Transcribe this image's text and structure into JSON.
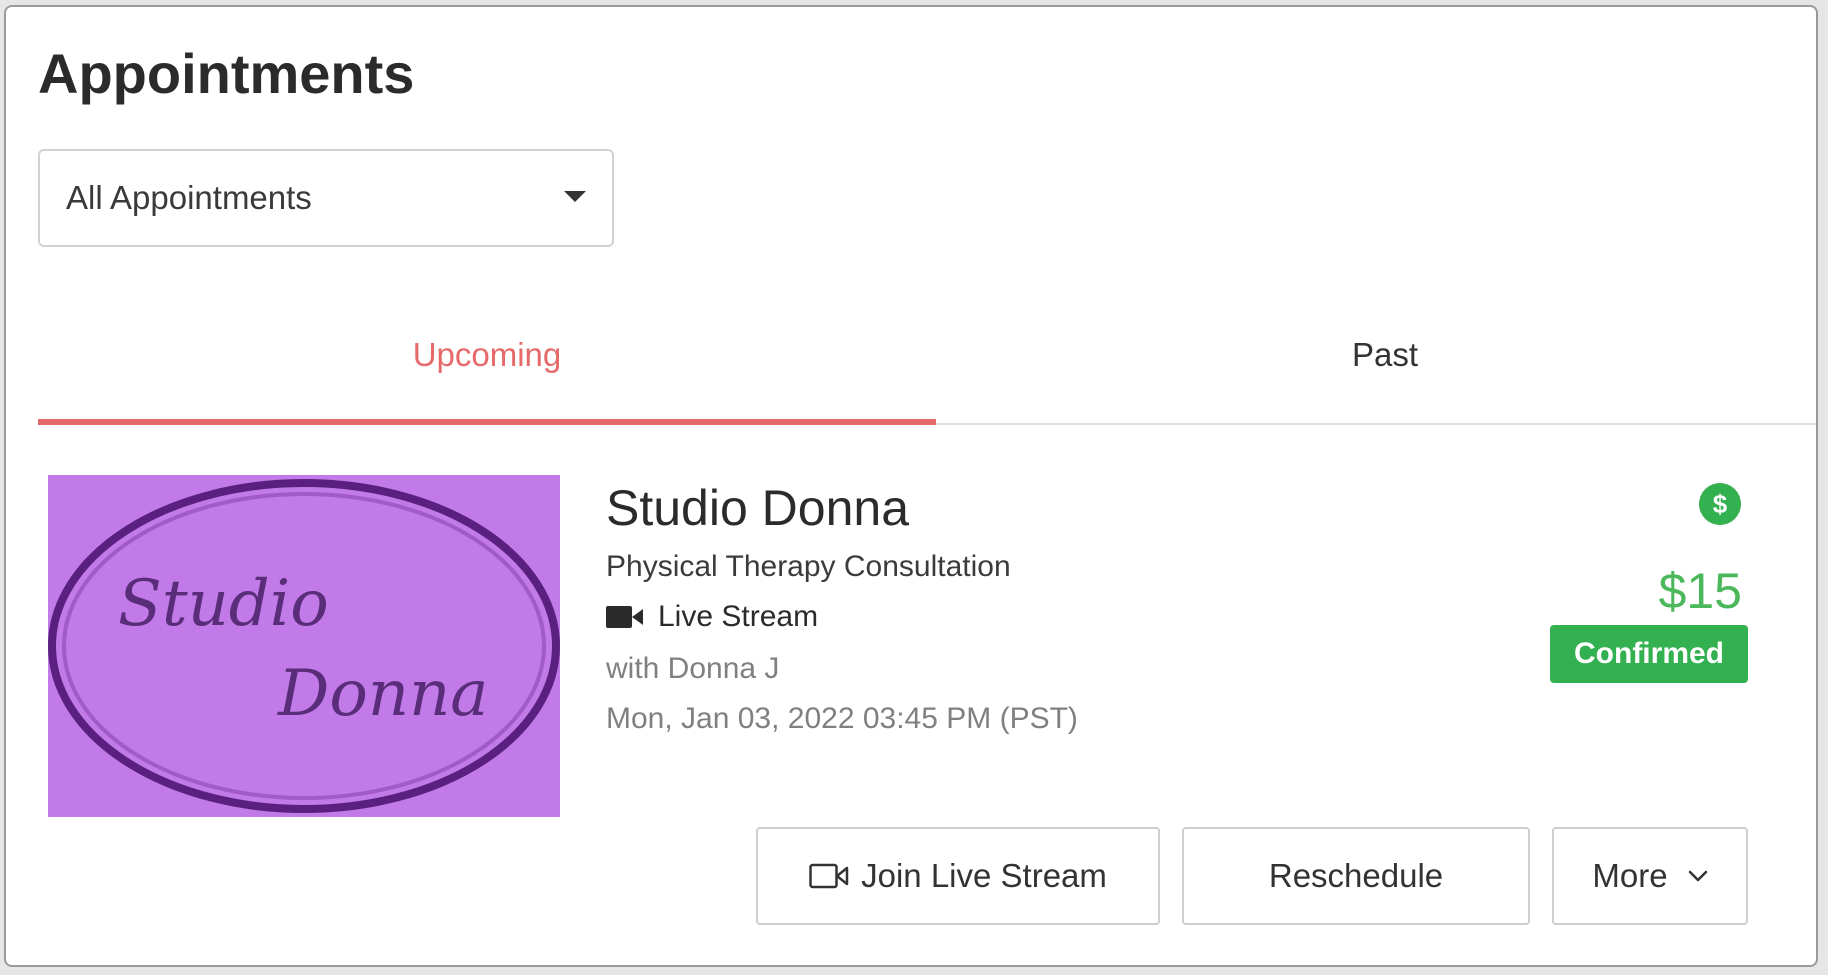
{
  "page": {
    "title": "Appointments"
  },
  "filter": {
    "selected": "All Appointments",
    "caret_icon": "caret-down-icon"
  },
  "tabs": [
    {
      "label": "Upcoming",
      "active": true
    },
    {
      "label": "Past",
      "active": false
    }
  ],
  "appointment": {
    "thumbnail_text_line1": "Studio",
    "thumbnail_text_line2": "Donna",
    "business_name": "Studio Donna",
    "service": "Physical Therapy Consultation",
    "mode_icon": "video-camera-icon",
    "mode": "Live Stream",
    "staff": "with Donna J",
    "datetime": "Mon, Jan 03, 2022 03:45 PM (PST)",
    "price_icon": "dollar-circle-icon",
    "price": "$15",
    "status": "Confirmed",
    "actions": {
      "join": "Join Live Stream",
      "reschedule": "Reschedule",
      "more": "More"
    }
  },
  "colors": {
    "accent": "#e26a6a",
    "price": "#4cb85c",
    "confirmed": "#33b050",
    "thumbnail_bg": "#c27ae8"
  }
}
